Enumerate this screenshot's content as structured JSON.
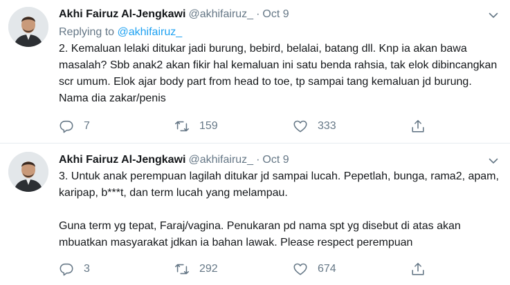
{
  "tweets": [
    {
      "display_name": "Akhi Fairuz Al-Jengkawi",
      "handle": "@akhifairuz_",
      "separator": "·",
      "date": "Oct 9",
      "reply_prefix": "Replying to ",
      "reply_mention": "@akhifairuz_",
      "text": "2. Kemaluan lelaki ditukar jadi burung, bebird, belalai, batang dll. Knp ia akan bawa masalah? Sbb anak2 akan fikir hal kemaluan ini satu benda rahsia, tak elok dibincangkan scr umum. Elok ajar body part from head to toe, tp sampai tang kemaluan jd burung. Nama dia zakar/penis",
      "replies": "7",
      "retweets": "159",
      "likes": "333"
    },
    {
      "display_name": "Akhi Fairuz Al-Jengkawi",
      "handle": "@akhifairuz_",
      "separator": "·",
      "date": "Oct 9",
      "text": "3. Untuk anak perempuan lagilah ditukar jd sampai lucah. Pepetlah, bunga, rama2, apam, karipap, b***t, dan term lucah yang melampau.\n\nGuna term yg tepat, Faraj/vagina. Penukaran pd nama spt yg disebut di atas akan mbuatkan masyarakat jdkan ia bahan lawak. Please respect perempuan",
      "replies": "3",
      "retweets": "292",
      "likes": "674"
    }
  ],
  "icons": {
    "reply": "reply-icon",
    "retweet": "retweet-icon",
    "like": "heart-icon",
    "share": "share-icon",
    "more": "chevron-down-icon"
  },
  "colors": {
    "text": "#14171a",
    "secondary": "#657786",
    "link": "#1da1f2",
    "divider": "#e6ecf0"
  }
}
